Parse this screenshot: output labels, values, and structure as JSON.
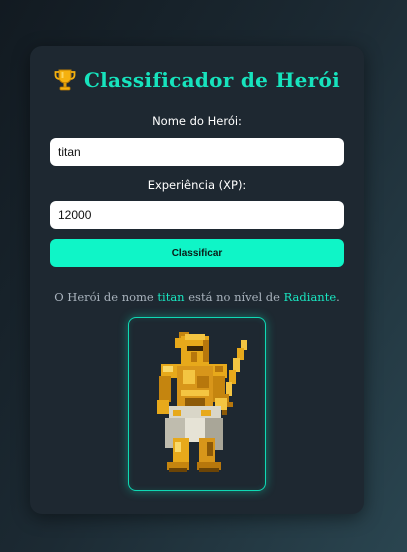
{
  "app": {
    "title": "Classificador de Herói",
    "title_icon": "trophy-icon"
  },
  "form": {
    "name_label": "Nome do Herói:",
    "name_value": "titan",
    "xp_label": "Experiência (XP):",
    "xp_value": "12000",
    "submit_label": "Classificar"
  },
  "result": {
    "prefix": "O Herói de nome ",
    "hero_name": "titan",
    "middle": " está no nível de ",
    "level": "Radiante",
    "suffix": "."
  },
  "hero_image": {
    "icon": "golden-knight-sprite"
  },
  "colors": {
    "accent": "#17e3bd",
    "button": "#0ff5c7",
    "card": "#1e2831",
    "text_muted": "#a9b3bd"
  }
}
